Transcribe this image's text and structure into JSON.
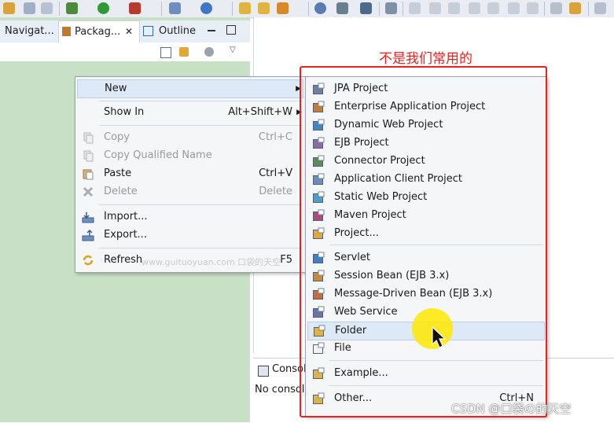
{
  "tabs": {
    "navigator": "Navigat...",
    "package": "Packag...",
    "outline": "Outline"
  },
  "context_menu": {
    "new": "New",
    "show_in": "Show In",
    "show_in_shortcut": "Alt+Shift+W",
    "copy": "Copy",
    "copy_shortcut": "Ctrl+C",
    "copy_qualified": "Copy Qualified Name",
    "paste": "Paste",
    "paste_shortcut": "Ctrl+V",
    "delete": "Delete",
    "delete_shortcut": "Delete",
    "import": "Import...",
    "export": "Export...",
    "refresh": "Refresh",
    "refresh_shortcut": "F5"
  },
  "new_submenu": {
    "items": [
      {
        "label": "JPA Project",
        "icon": "jpa-project-icon"
      },
      {
        "label": "Enterprise Application Project",
        "icon": "ear-project-icon"
      },
      {
        "label": "Dynamic Web Project",
        "icon": "web-project-icon"
      },
      {
        "label": "EJB Project",
        "icon": "ejb-project-icon"
      },
      {
        "label": "Connector Project",
        "icon": "connector-project-icon"
      },
      {
        "label": "Application Client Project",
        "icon": "app-client-icon"
      },
      {
        "label": "Static Web Project",
        "icon": "static-web-icon"
      },
      {
        "label": "Maven Project",
        "icon": "maven-icon"
      },
      {
        "label": "Project...",
        "icon": "project-icon"
      },
      {
        "label": "Servlet",
        "icon": "servlet-icon"
      },
      {
        "label": "Session Bean (EJB 3.x)",
        "icon": "session-bean-icon"
      },
      {
        "label": "Message-Driven Bean (EJB 3.x)",
        "icon": "mdb-icon"
      },
      {
        "label": "Web Service",
        "icon": "web-service-icon"
      },
      {
        "label": "Folder",
        "icon": "folder-icon"
      },
      {
        "label": "File",
        "icon": "file-icon"
      },
      {
        "label": "Example...",
        "icon": "example-icon"
      },
      {
        "label": "Other...",
        "icon": "other-icon",
        "shortcut": "Ctrl+N"
      }
    ]
  },
  "annotation": {
    "label": "不是我们常用的",
    "color": "#e8231f"
  },
  "console": {
    "tab": "Consol",
    "text": "No consol"
  },
  "watermark": "CSDN @口袋の的天空",
  "watermark_faint": "www.guituoyuan.com 口袋的天空"
}
